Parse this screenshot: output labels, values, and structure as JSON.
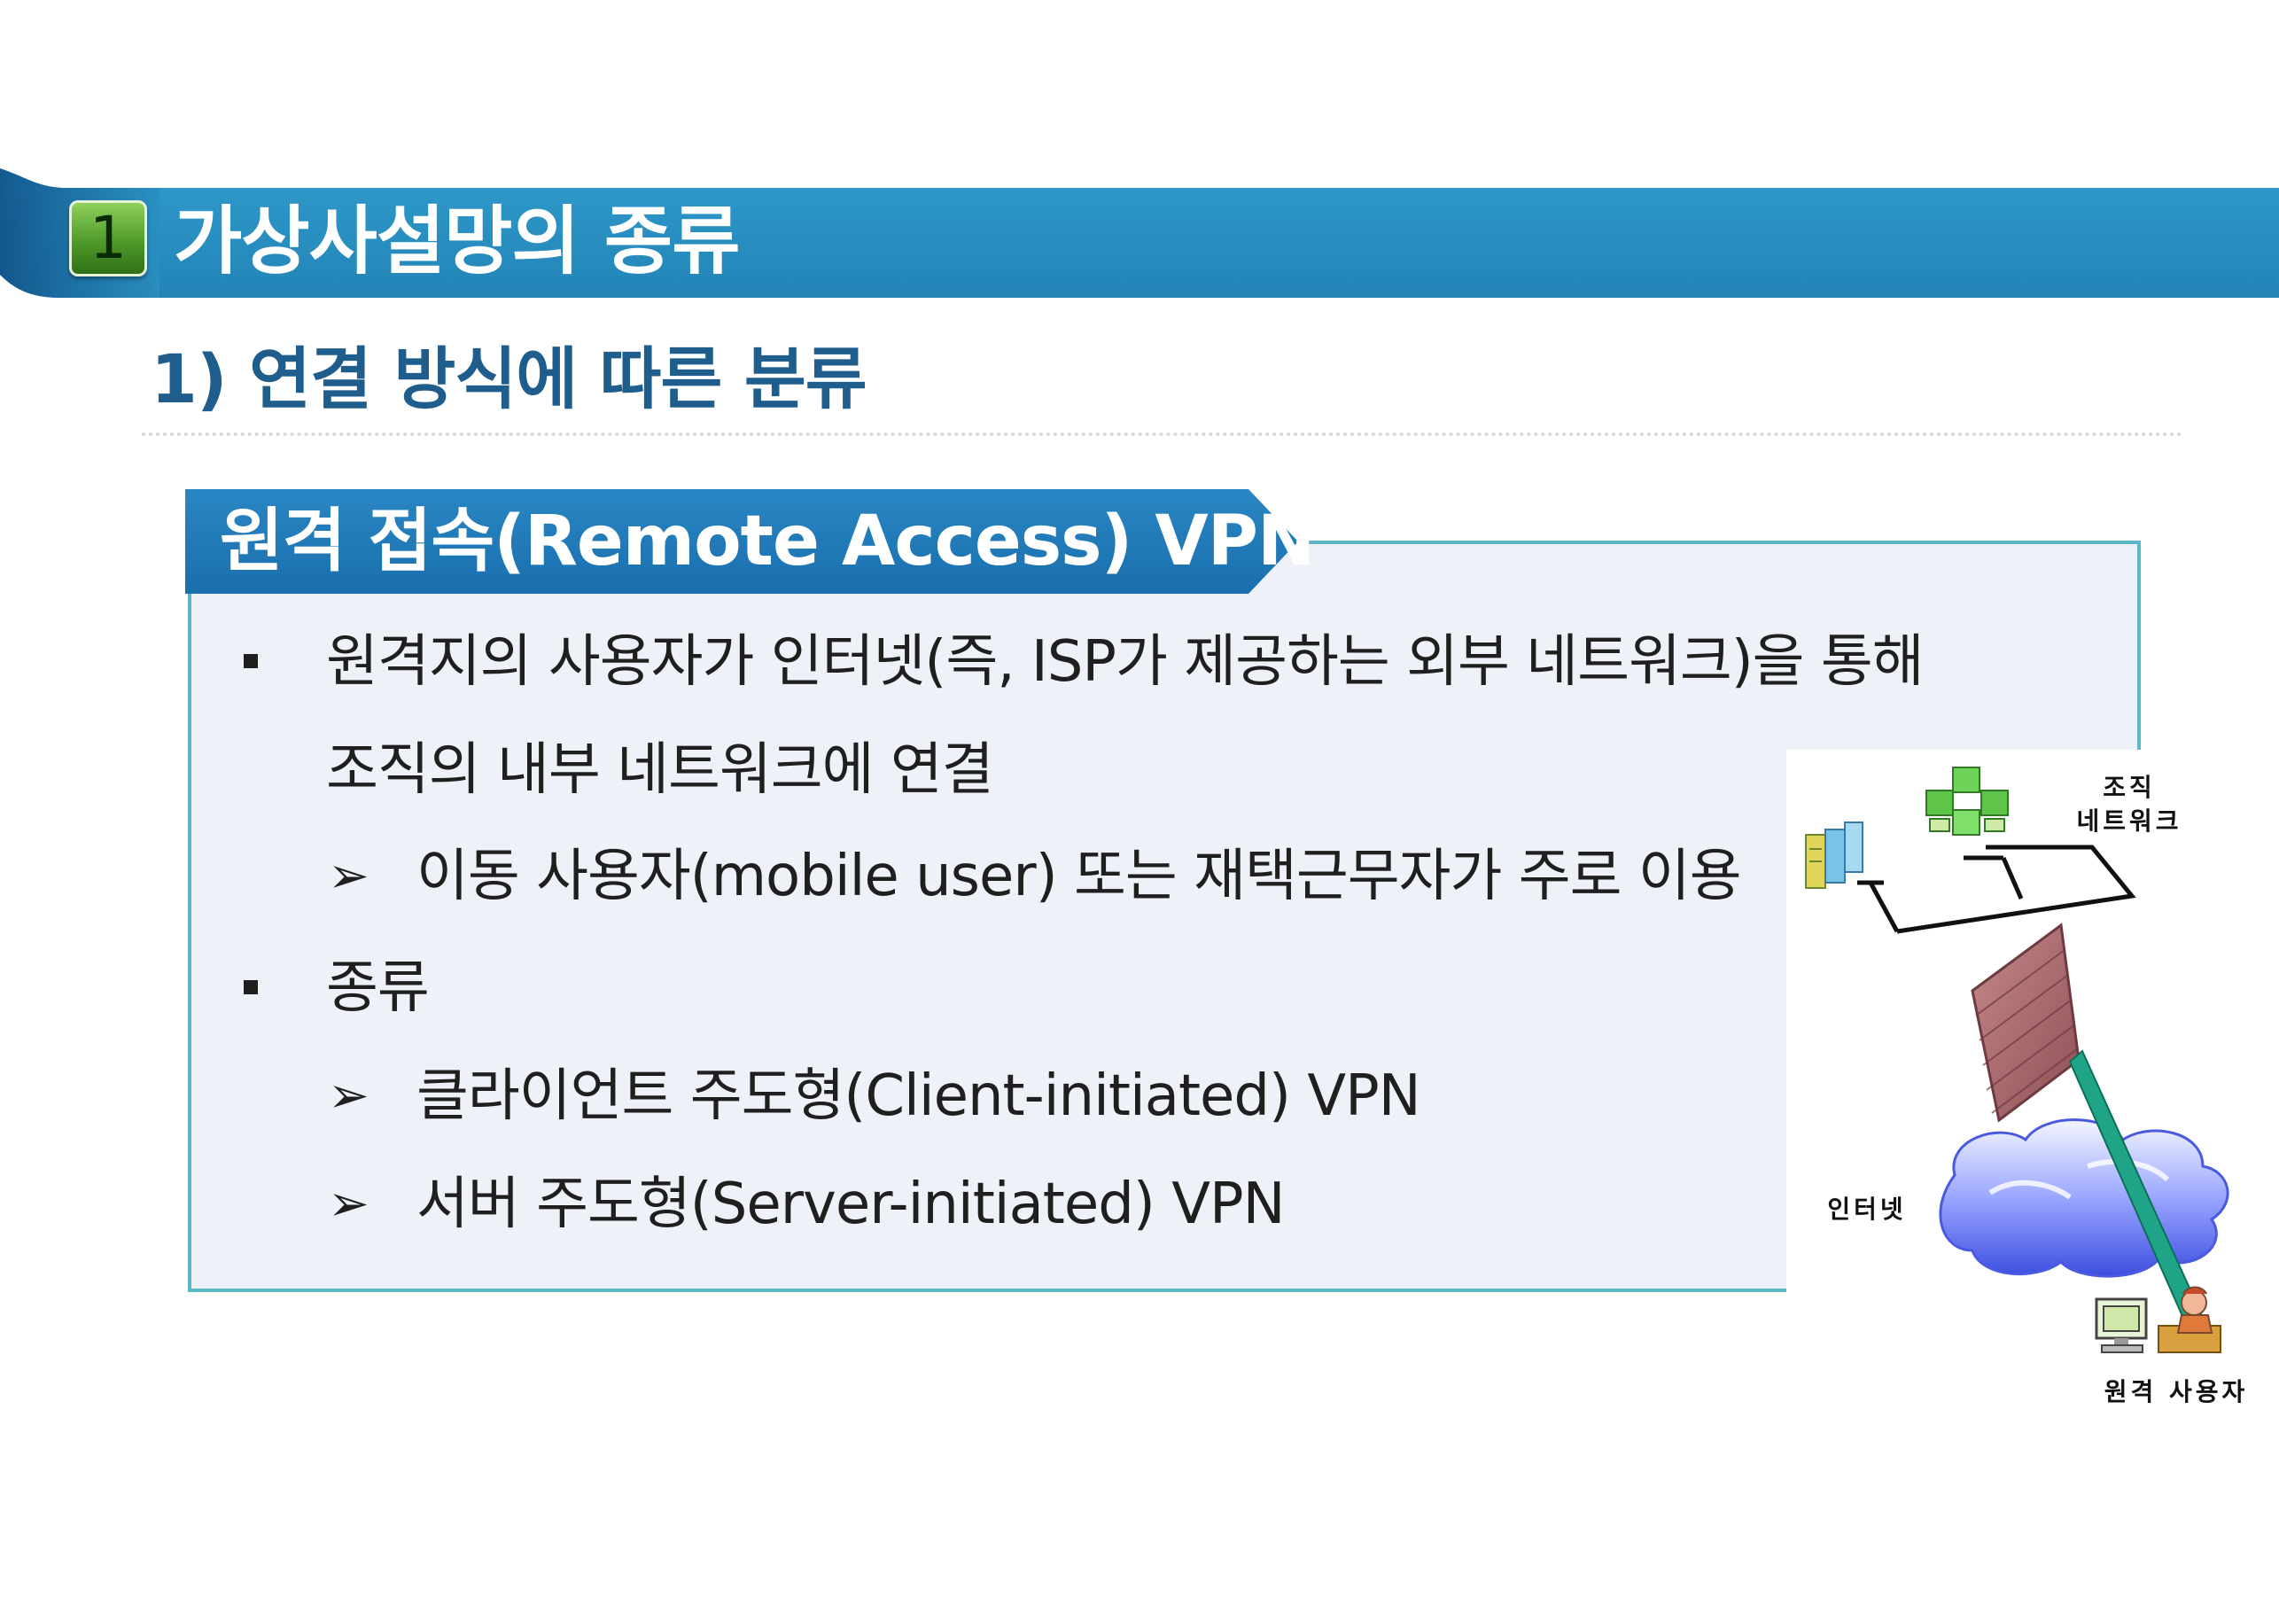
{
  "header": {
    "chapter_number": "1",
    "title": "가상사설망의 종류"
  },
  "section": {
    "title": "1) 연결 방식에 따른 분류"
  },
  "content": {
    "tab_title": "원격 접속(Remote Access) VPN",
    "bullet1_line1": "원격지의 사용자가 인터넷(즉, ISP가 제공하는 외부 네트워크)을 통해",
    "bullet1_line2": "조직의 내부 네트워크에 연결",
    "sub1": "이동 사용자(mobile user) 또는 재택근무자가 주로 이용",
    "bullet2": "종류",
    "sub2": "클라이언트 주도형(Client-initiated) VPN",
    "sub3": "서버 주도형(Server-initiated) VPN"
  },
  "diagram": {
    "org_network_line1": "조직",
    "org_network_line2": "네트워크",
    "internet": "인터넷",
    "remote_user": "원격 사용자"
  },
  "colors": {
    "header_band": "#2a8fc0",
    "tab_blue": "#1f7ab8",
    "box_border": "#5bb7c6",
    "box_fill": "#eef2f8",
    "section_title": "#1f5e8c"
  }
}
